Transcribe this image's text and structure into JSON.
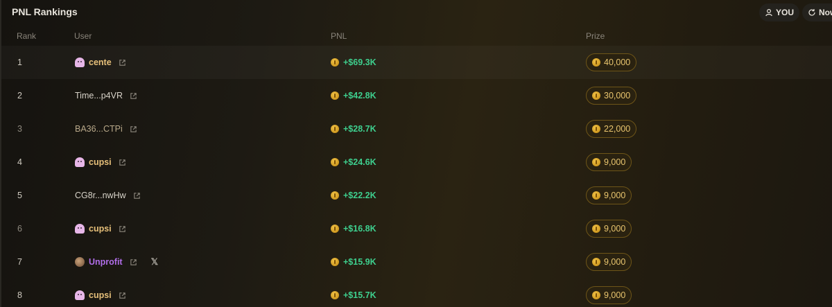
{
  "header": {
    "title": "PNL Rankings",
    "you_label": "YOU",
    "now_label": "Now"
  },
  "columns": {
    "rank": "Rank",
    "user": "User",
    "pnl": "PNL",
    "prize": "Prize"
  },
  "rows": [
    {
      "rank": "1",
      "user": "cente",
      "avatar": "ghost-icon",
      "style": "gold",
      "pnl": "+$69.3K",
      "prize": "40,000"
    },
    {
      "rank": "2",
      "user": "Time...p4VR",
      "avatar": null,
      "style": "white",
      "pnl": "+$42.8K",
      "prize": "30,000"
    },
    {
      "rank": "3",
      "user": "BA36...CTPi",
      "avatar": null,
      "style": "muted",
      "pnl": "+$28.7K",
      "prize": "22,000"
    },
    {
      "rank": "4",
      "user": "cupsi",
      "avatar": "ghost-icon",
      "style": "gold",
      "pnl": "+$24.6K",
      "prize": "9,000"
    },
    {
      "rank": "5",
      "user": "CG8r...nwHw",
      "avatar": null,
      "style": "white",
      "pnl": "+$22.2K",
      "prize": "9,000"
    },
    {
      "rank": "6",
      "user": "cupsi",
      "avatar": "ghost-icon",
      "style": "gold",
      "pnl": "+$16.8K",
      "prize": "9,000"
    },
    {
      "rank": "7",
      "user": "Unprofit",
      "avatar": "photo-avatar",
      "style": "purple",
      "pnl": "+$15.9K",
      "prize": "9,000",
      "x_link": true
    },
    {
      "rank": "8",
      "user": "cupsi",
      "avatar": "ghost-icon",
      "style": "gold",
      "pnl": "+$15.7K",
      "prize": "9,000"
    }
  ],
  "colors": {
    "pnl_positive": "#3ecf8e",
    "prize_gold": "#e9c56e",
    "accent_purple": "#b06de8"
  }
}
